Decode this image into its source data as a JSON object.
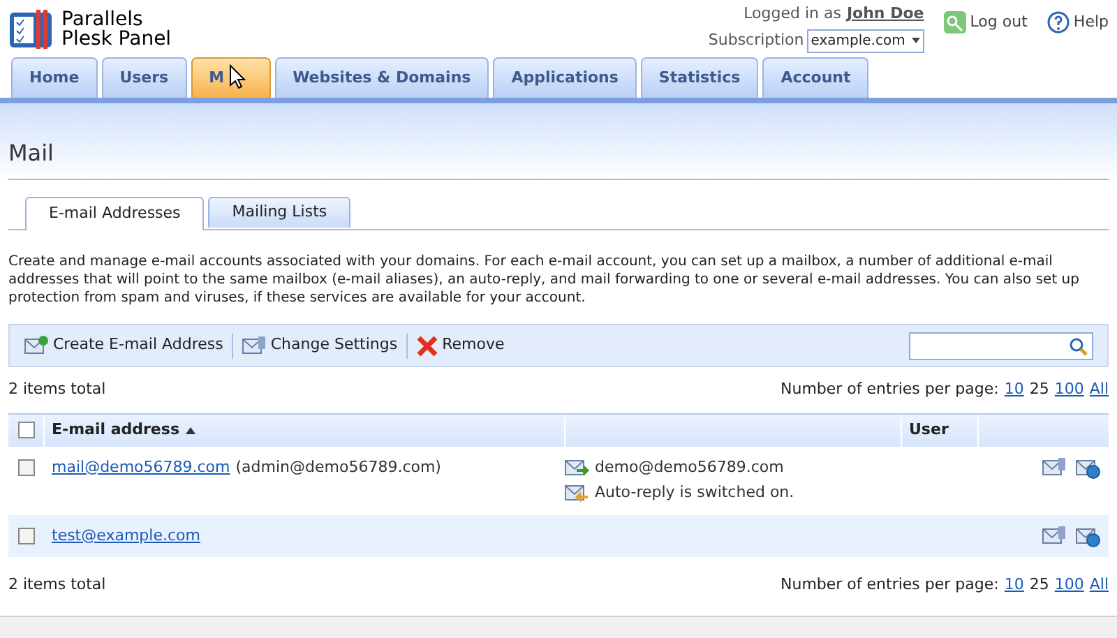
{
  "logo": {
    "line1": "Parallels",
    "line2": "Plesk Panel"
  },
  "header": {
    "logged_in_label": "Logged in as",
    "user": "John Doe",
    "subscription_label": "Subscription",
    "subscription": "example.com",
    "logout": "Log out",
    "help": "Help"
  },
  "tabs": [
    {
      "label": "Home",
      "selected": false,
      "hovered": false
    },
    {
      "label": "Users",
      "selected": false,
      "hovered": false
    },
    {
      "label": "M",
      "selected": true,
      "hovered": true
    },
    {
      "label": "Websites & Domains",
      "selected": false,
      "hovered": false
    },
    {
      "label": "Applications",
      "selected": false,
      "hovered": false
    },
    {
      "label": "Statistics",
      "selected": false,
      "hovered": false
    },
    {
      "label": "Account",
      "selected": false,
      "hovered": false
    }
  ],
  "page_title": "Mail",
  "subtabs": [
    {
      "label": "E-mail Addresses",
      "selected": true
    },
    {
      "label": "Mailing Lists",
      "selected": false
    }
  ],
  "description": "Create and manage e-mail accounts associated with your domains. For each e-mail account, you can set up a mailbox, a number of additional e-mail addresses that will point to the same mailbox (e-mail aliases), an auto-reply, and mail forwarding to one or several e-mail addresses. You can also set up protection from spam and viruses, if these services are available for your account.",
  "toolbar": [
    {
      "label": "Create E-mail Address",
      "kind": "create"
    },
    {
      "label": "Change Settings",
      "kind": "settings"
    },
    {
      "label": "Remove",
      "kind": "remove"
    }
  ],
  "pager_top": {
    "total": "2 items total",
    "label": "Number of entries per page:",
    "options": [
      {
        "label": "10",
        "selected": false
      },
      {
        "label": "25",
        "selected": true
      },
      {
        "label": "100",
        "selected": false
      },
      {
        "label": "All",
        "selected": false
      }
    ]
  },
  "table": {
    "columns": [
      "E-mail address",
      "",
      "User"
    ],
    "select_all_checked": false,
    "rows": [
      {
        "checked": false,
        "address": "mail@demo56789.com",
        "alias": "(admin@demo56789.com)",
        "details": [
          {
            "kind": "forward",
            "text": "demo@demo56789.com"
          },
          {
            "kind": "autoreply",
            "text": "Auto-reply is switched on."
          }
        ]
      },
      {
        "checked": false,
        "address": "test@example.com",
        "details": []
      }
    ]
  },
  "pager_bottom": {
    "total": "2 items total",
    "label": "Number of entries per page:",
    "options": [
      {
        "label": "10",
        "selected": false
      },
      {
        "label": "25",
        "selected": true
      },
      {
        "label": "100",
        "selected": false
      },
      {
        "label": "All",
        "selected": false
      }
    ]
  }
}
